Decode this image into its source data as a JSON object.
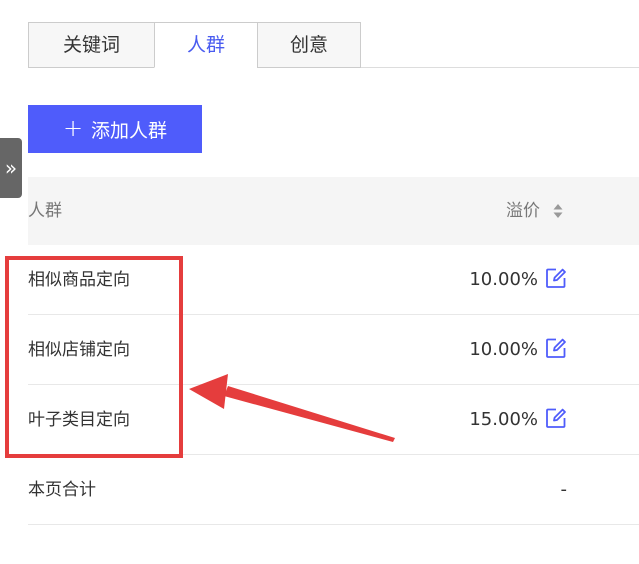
{
  "tabs": [
    {
      "label": "关键词",
      "active": false
    },
    {
      "label": "人群",
      "active": true
    },
    {
      "label": "创意",
      "active": false
    }
  ],
  "add_button": {
    "label": "添加人群",
    "icon": "plus-icon"
  },
  "side_toggle": {
    "glyph": "»",
    "icon": "double-chevron-right-icon"
  },
  "table": {
    "headers": {
      "name": "人群",
      "price": "溢价"
    },
    "rows": [
      {
        "name": "相似商品定向",
        "value": "10.00%"
      },
      {
        "name": "相似店铺定向",
        "value": "10.00%"
      },
      {
        "name": "叶子类目定向",
        "value": "15.00%"
      }
    ],
    "total": {
      "name": "本页合计",
      "value": "-"
    }
  },
  "colors": {
    "accent": "#4f5cfb",
    "active_tab_text": "#4a5cf0",
    "annotation_red": "#e53d3d"
  }
}
